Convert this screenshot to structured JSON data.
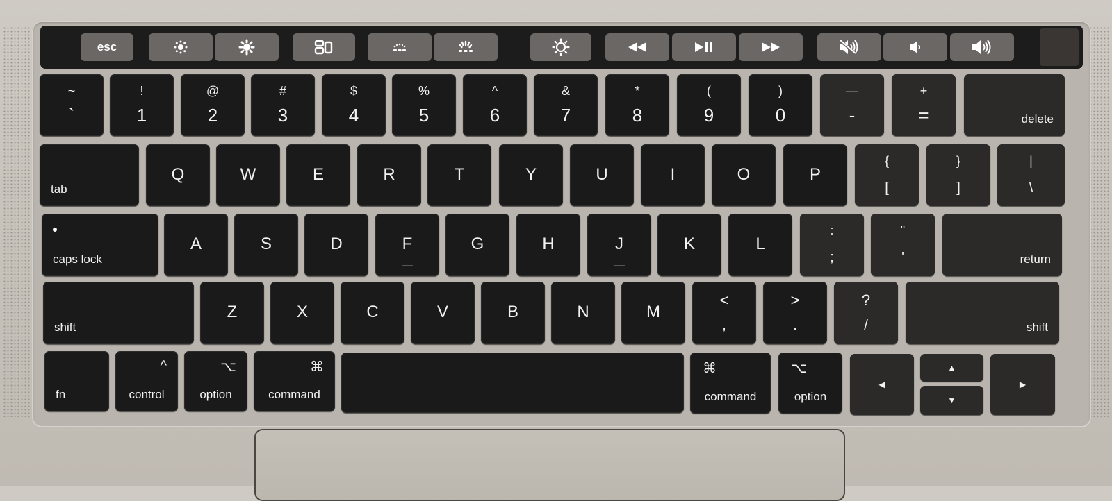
{
  "touch_bar": {
    "buttons": [
      {
        "id": "esc",
        "label": "esc",
        "icon": null
      },
      {
        "id": "brightness-down",
        "label": "",
        "icon": "brightness-down-icon"
      },
      {
        "id": "brightness-up",
        "label": "",
        "icon": "brightness-up-icon"
      },
      {
        "id": "mission-control",
        "label": "",
        "icon": "mission-control-icon"
      },
      {
        "id": "kbd-light-down",
        "label": "",
        "icon": "keyboard-brightness-down-icon"
      },
      {
        "id": "kbd-light-up",
        "label": "",
        "icon": "keyboard-brightness-up-icon"
      },
      {
        "id": "night-shift",
        "label": "",
        "icon": "night-shift-icon"
      },
      {
        "id": "rewind",
        "label": "◀◀",
        "icon": "rewind-icon"
      },
      {
        "id": "play-pause",
        "label": "▶❚❚",
        "icon": "play-pause-icon"
      },
      {
        "id": "fast-forward",
        "label": "▶▶",
        "icon": "fast-forward-icon"
      },
      {
        "id": "mute",
        "label": "",
        "icon": "mute-icon"
      },
      {
        "id": "volume-down",
        "label": "",
        "icon": "volume-down-icon"
      },
      {
        "id": "volume-up",
        "label": "",
        "icon": "volume-up-icon"
      }
    ]
  },
  "number_row": {
    "keys": [
      {
        "top": "~",
        "bottom": "`"
      },
      {
        "top": "!",
        "bottom": "1"
      },
      {
        "top": "@",
        "bottom": "2"
      },
      {
        "top": "#",
        "bottom": "3"
      },
      {
        "top": "$",
        "bottom": "4"
      },
      {
        "top": "%",
        "bottom": "5"
      },
      {
        "top": "^",
        "bottom": "6"
      },
      {
        "top": "&",
        "bottom": "7"
      },
      {
        "top": "*",
        "bottom": "8"
      },
      {
        "top": "(",
        "bottom": "9"
      },
      {
        "top": ")",
        "bottom": "0"
      },
      {
        "top": "—",
        "bottom": "-"
      },
      {
        "top": "+",
        "bottom": "="
      }
    ],
    "delete_label": "delete"
  },
  "qwerty_row": {
    "tab_label": "tab",
    "letters": [
      "Q",
      "W",
      "E",
      "R",
      "T",
      "Y",
      "U",
      "I",
      "O",
      "P"
    ],
    "symbols": [
      {
        "top": "{",
        "bottom": "["
      },
      {
        "top": "}",
        "bottom": "]"
      },
      {
        "top": "|",
        "bottom": "\\"
      }
    ]
  },
  "home_row": {
    "caps_label": "caps lock",
    "letters": [
      "A",
      "S",
      "D",
      "F",
      "G",
      "H",
      "J",
      "K",
      "L"
    ],
    "symbols": [
      {
        "top": ":",
        "bottom": ";"
      },
      {
        "top": "\"",
        "bottom": "'"
      }
    ],
    "return_label": "return"
  },
  "bottom_letter_row": {
    "shift_label": "shift",
    "letters": [
      "Z",
      "X",
      "C",
      "V",
      "B",
      "N",
      "M"
    ],
    "symbols": [
      {
        "top": "<",
        "bottom": ","
      },
      {
        "top": ">",
        "bottom": "."
      },
      {
        "top": "?",
        "bottom": "/"
      }
    ]
  },
  "modifier_row": {
    "fn": "fn",
    "control": {
      "label": "control",
      "symbol": "^"
    },
    "option": {
      "label": "option",
      "symbol": "⌥"
    },
    "command": {
      "label": "command",
      "symbol": "⌘"
    },
    "arrows": {
      "left": "◀",
      "up": "▲",
      "down": "▼",
      "right": "▶"
    }
  }
}
